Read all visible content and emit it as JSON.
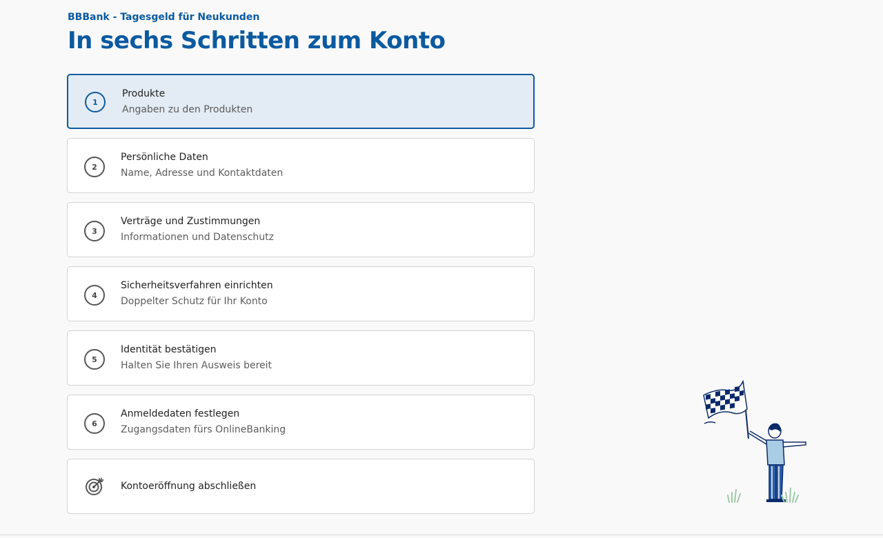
{
  "header": {
    "eyebrow": "BBBank - Tagesgeld für Neukunden",
    "title": "In sechs Schritten zum Konto"
  },
  "steps": [
    {
      "number": "1",
      "title": "Produkte",
      "subtitle": "Angaben zu den Produkten",
      "active": true
    },
    {
      "number": "2",
      "title": "Persönliche Daten",
      "subtitle": "Name, Adresse und Kontaktdaten",
      "active": false
    },
    {
      "number": "3",
      "title": "Verträge und Zustimmungen",
      "subtitle": "Informationen und Datenschutz",
      "active": false
    },
    {
      "number": "4",
      "title": "Sicherheitsverfahren einrichten",
      "subtitle": "Doppelter Schutz für Ihr Konto",
      "active": false
    },
    {
      "number": "5",
      "title": "Identität bestätigen",
      "subtitle": "Halten Sie Ihren Ausweis bereit",
      "active": false
    },
    {
      "number": "6",
      "title": "Anmeldedaten festlegen",
      "subtitle": "Zugangsdaten fürs OnlineBanking",
      "active": false
    }
  ],
  "final_step": {
    "title": "Kontoeröffnung abschließen",
    "icon": "target-icon"
  },
  "illustration": {
    "icon": "checkered-flag-person-illustration"
  },
  "colors": {
    "brand_blue": "#0b5aa0",
    "active_bg": "#e3ebf5",
    "card_border": "#d3d3d3",
    "page_bg": "#f9f9f9"
  }
}
